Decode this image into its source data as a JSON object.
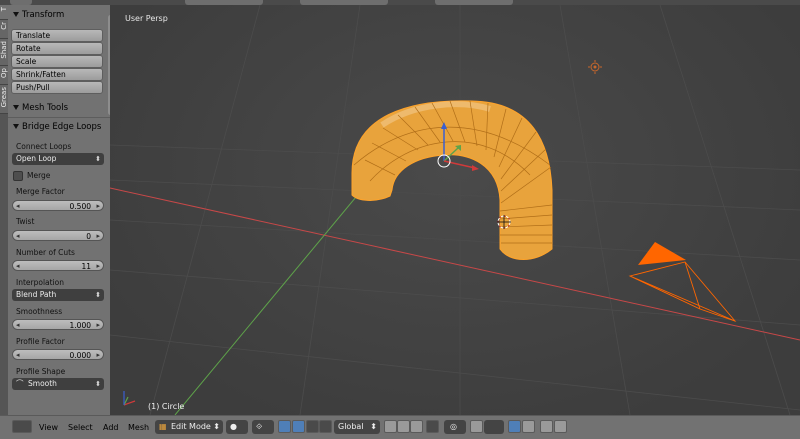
{
  "viewport": {
    "view_label": "User Persp",
    "object_label": "(1) Circle"
  },
  "vertical_tabs": [
    "T",
    "Cr",
    "Shad",
    "Op",
    "Greas"
  ],
  "shelf": {
    "transform_header": "Transform",
    "transform_buttons": [
      "Translate",
      "Rotate",
      "Scale",
      "Shrink/Fatten",
      "Push/Pull"
    ],
    "mesh_tools_header": "Mesh Tools",
    "bridge_header": "Bridge Edge Loops",
    "connect_loops_label": "Connect Loops",
    "connect_loops_value": "Open Loop",
    "merge_label": "Merge",
    "merge_factor_label": "Merge Factor",
    "merge_factor_value": "0.500",
    "twist_label": "Twist",
    "twist_value": "0",
    "cuts_label": "Number of Cuts",
    "cuts_value": "11",
    "interpolation_label": "Interpolation",
    "interpolation_value": "Blend Path",
    "smoothness_label": "Smoothness",
    "smoothness_value": "1.000",
    "profile_factor_label": "Profile Factor",
    "profile_factor_value": "0.000",
    "profile_shape_label": "Profile Shape",
    "profile_shape_value": "Smooth"
  },
  "bottombar": {
    "menu_view": "View",
    "menu_select": "Select",
    "menu_add": "Add",
    "menu_mesh": "Mesh",
    "mode": "Edit Mode",
    "orientation": "Global"
  },
  "colors": {
    "mesh": "#e8a33c",
    "wire": "#ff9a1a",
    "camera": "#ff6600",
    "x_axis": "#c84848",
    "y_axis": "#5ea34a",
    "accent_blue": "#4f7fb8"
  },
  "icons": {
    "editor_type": "3d-view-icon",
    "camera": "camera-icon",
    "lamp": "lamp-icon",
    "cursor": "3d-cursor-icon"
  }
}
